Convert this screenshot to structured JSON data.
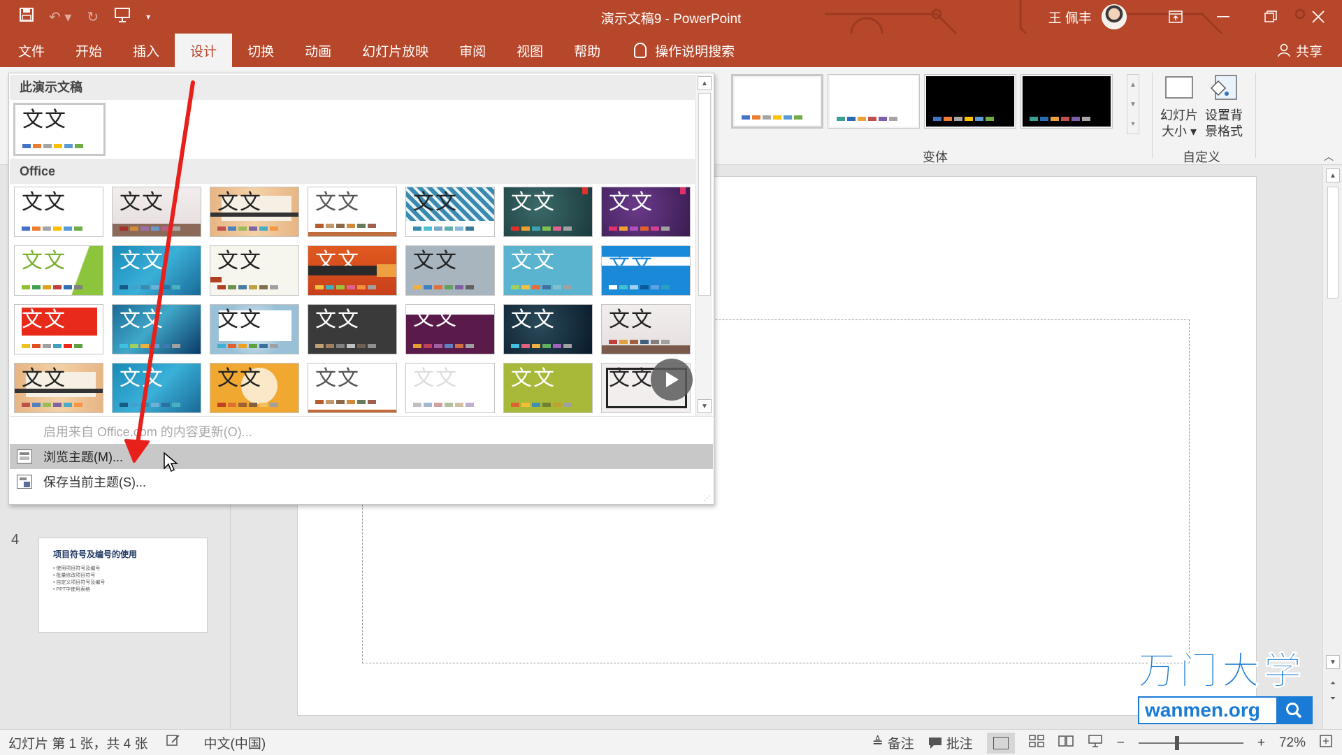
{
  "app": {
    "doc_title": "演示文稿9 - PowerPoint",
    "user_name": "王 佩丰"
  },
  "quick_access": [
    "save-icon",
    "undo-icon",
    "redo-icon",
    "start-from-beginning-icon",
    "customize-icon"
  ],
  "window_controls": [
    "ribbon-display-icon",
    "minimize-icon",
    "restore-icon",
    "close-icon"
  ],
  "tabs": [
    {
      "label": "文件"
    },
    {
      "label": "开始"
    },
    {
      "label": "插入"
    },
    {
      "label": "设计",
      "active": true
    },
    {
      "label": "切换"
    },
    {
      "label": "动画"
    },
    {
      "label": "幻灯片放映"
    },
    {
      "label": "审阅"
    },
    {
      "label": "视图"
    },
    {
      "label": "帮助"
    }
  ],
  "tell_me": "操作说明搜索",
  "share": "共享",
  "ribbon": {
    "variants_label": "变体",
    "customize_label": "自定义",
    "slide_size": "幻灯片大小",
    "format_background_line1": "设置背",
    "format_background_line2": "景格式",
    "slide_size_line1": "幻灯片",
    "slide_size_line2": "大小 ▾"
  },
  "gallery": {
    "section_current": "此演示文稿",
    "section_office": "Office",
    "glyph": "文文",
    "menu": {
      "enable_updates": "启用来自 Office.com 的内容更新(O)...",
      "browse_themes": "浏览主题(M)...",
      "save_theme": "保存当前主题(S)..."
    }
  },
  "slides_pane": {
    "slide4_number": "4",
    "slide4_title": "项目符号及编号的使用",
    "slide4_lines": [
      "• 使用项目符号及编号",
      "• 批量修改项目符号",
      "• 自定义项目符号及编号",
      "• PPT中使用表格"
    ]
  },
  "statusbar": {
    "slide_info": "幻灯片 第 1 张，共 4 张",
    "language": "中文(中国)",
    "notes": "备注",
    "comments": "批注",
    "zoom": "72%"
  },
  "watermark": {
    "brand": "万门大学",
    "url": "wanmen.org"
  },
  "colors": {
    "accent": "#b7472a",
    "annotation_arrow": "#e8201c",
    "watermark_blue": "#1a7bd6"
  }
}
